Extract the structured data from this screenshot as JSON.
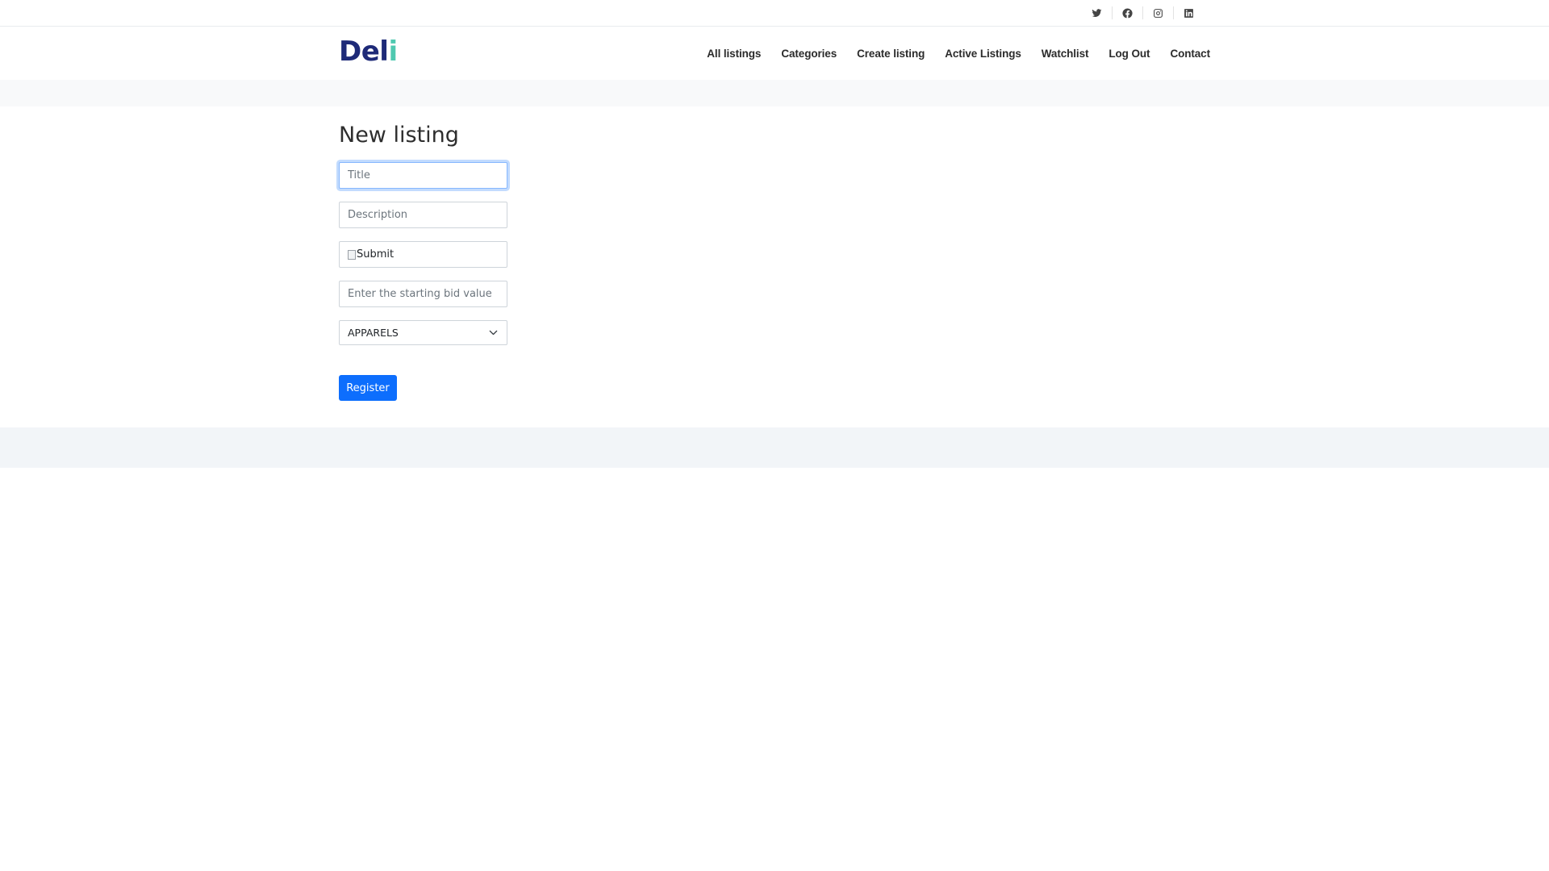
{
  "social": {
    "icons": [
      "twitter-icon",
      "facebook-icon",
      "instagram-icon",
      "linkedin-icon"
    ]
  },
  "brand": {
    "logo_main": "Del",
    "logo_accent": "i",
    "color_main": "#1e2a78",
    "color_accent": "#4fc9b0"
  },
  "nav": {
    "items": [
      "All listings",
      "Categories",
      "Create listing",
      "Active Listings",
      "Watchlist",
      "Log Out",
      "Contact"
    ]
  },
  "form": {
    "heading": "New listing",
    "title_placeholder": "Title",
    "description_placeholder": "Description",
    "image_alt": "Submit",
    "bid_placeholder": "Enter the starting bid value",
    "category_selected": "APPARELS",
    "submit_label": "Register",
    "button_color": "#0d6efd"
  }
}
